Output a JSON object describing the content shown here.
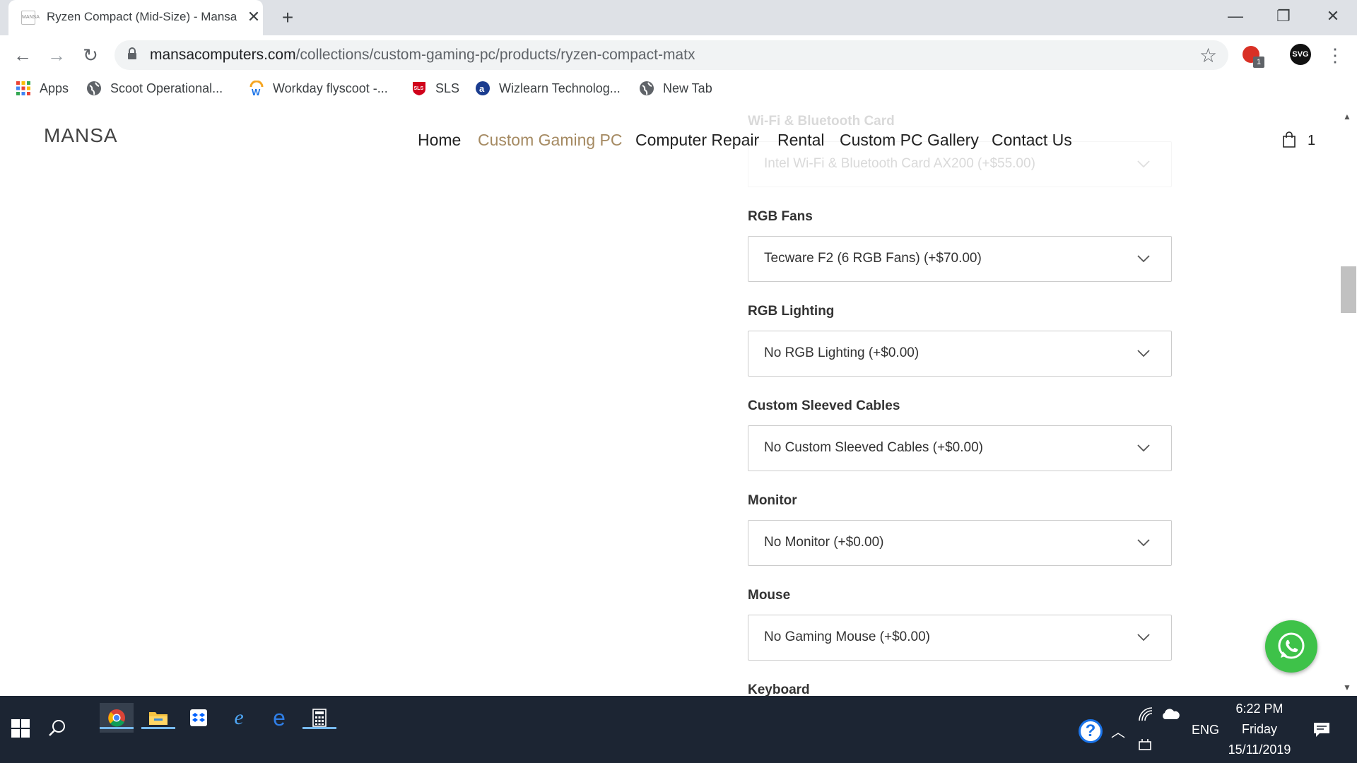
{
  "browser": {
    "tab_title": "Ryzen Compact (Mid-Size) - Mansa",
    "favicon_text": "MANSA",
    "new_tab": "+",
    "url_host": "mansacomputers.com",
    "url_path": "/collections/custom-gaming-pc/products/ryzen-compact-matx",
    "ext_badge": "1",
    "profile_initials": "SVG",
    "bookmarks": [
      {
        "label": "Apps",
        "icon": "apps-grid-icon"
      },
      {
        "label": "Scoot Operational...",
        "icon": "globe-icon"
      },
      {
        "label": "Workday flyscoot -...",
        "icon": "workday-icon"
      },
      {
        "label": "SLS",
        "icon": "sls-shield-icon"
      },
      {
        "label": "Wizlearn Technolog...",
        "icon": "wizlearn-icon"
      },
      {
        "label": "New Tab",
        "icon": "globe-icon"
      }
    ]
  },
  "site": {
    "logo": "MANSA",
    "nav": [
      "Home",
      "Custom Gaming PC",
      "Computer Repair",
      "Rental",
      "Custom PC Gallery",
      "Contact Us"
    ],
    "cart_count": "1",
    "accent": "#a58a62"
  },
  "options": [
    {
      "label": "Wi-Fi & Bluetooth Card",
      "value": "Intel Wi-Fi & Bluetooth Card AX200 (+$55.00)"
    },
    {
      "label": "RGB Fans",
      "value": "Tecware F2 (6 RGB Fans) (+$70.00)"
    },
    {
      "label": "RGB Lighting",
      "value": "No RGB Lighting (+$0.00)"
    },
    {
      "label": "Custom Sleeved Cables",
      "value": "No Custom Sleeved Cables (+$0.00)"
    },
    {
      "label": "Monitor",
      "value": "No Monitor (+$0.00)"
    },
    {
      "label": "Mouse",
      "value": "No Gaming Mouse (+$0.00)"
    },
    {
      "label": "Keyboard",
      "value": ""
    }
  ],
  "taskbar": {
    "language": "ENG",
    "time": "6:22 PM",
    "day": "Friday",
    "date": "15/11/2019"
  }
}
